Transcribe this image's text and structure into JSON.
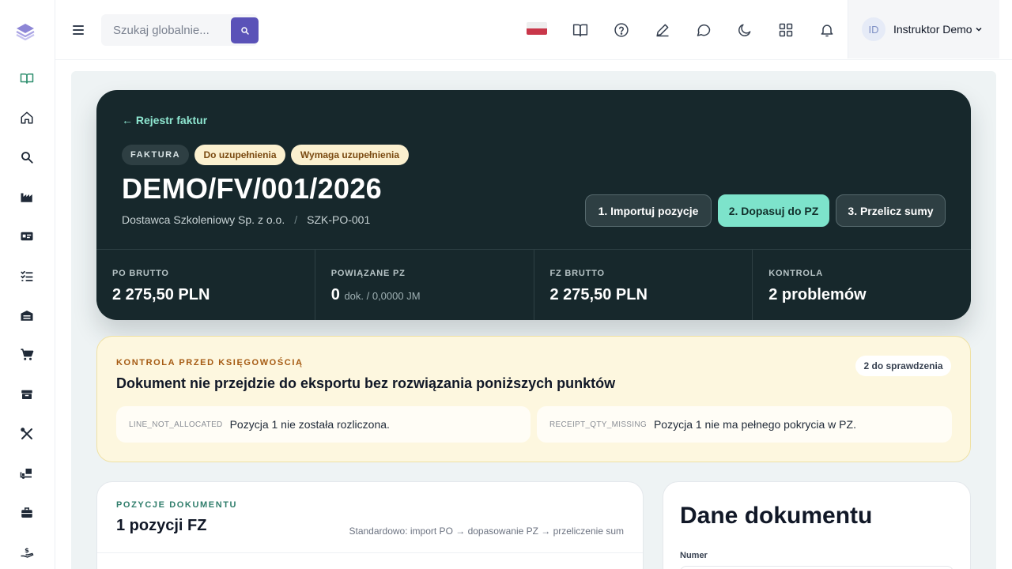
{
  "sidebar": {
    "logo": "layers-logo-icon",
    "items": [
      {
        "icon": "book-open-icon",
        "active": true
      },
      {
        "icon": "home-icon"
      },
      {
        "icon": "search-zoom-icon"
      },
      {
        "icon": "factory-icon"
      },
      {
        "icon": "id-card-icon"
      },
      {
        "icon": "list-check-icon"
      },
      {
        "icon": "warehouse-icon"
      },
      {
        "icon": "cart-icon"
      },
      {
        "icon": "box-icon"
      },
      {
        "icon": "tools-icon"
      },
      {
        "icon": "truck-loading-icon"
      },
      {
        "icon": "briefcase-icon"
      },
      {
        "icon": "hand-dollar-icon"
      }
    ]
  },
  "topbar": {
    "search_placeholder": "Szukaj globalnie...",
    "icons": [
      "book-icon",
      "help-circle-icon",
      "pen-icon",
      "chat-icon",
      "moon-icon",
      "grid-icon",
      "bell-icon"
    ],
    "user": {
      "initials": "ID",
      "name": "Instruktor Demo"
    }
  },
  "hero": {
    "back_link": "← Rejestr faktur",
    "chips": [
      "FAKTURA",
      "Do uzupełnienia",
      "Wymaga uzupełnienia"
    ],
    "title": "DEMO/FV/001/2026",
    "supplier": "Dostawca Szkoleniowy Sp. z o.o.",
    "separator": "/",
    "po_ref": "SZK-PO-001",
    "steps": [
      "1. Importuj pozycje",
      "2. Dopasuj do PZ",
      "3. Przelicz sumy"
    ],
    "stats": [
      {
        "label": "PO BRUTTO",
        "value": "2 275,50 PLN",
        "extra": ""
      },
      {
        "label": "POWIĄZANE PZ",
        "value": "0",
        "extra": "dok. / 0,0000 JM"
      },
      {
        "label": "FZ BRUTTO",
        "value": "2 275,50 PLN",
        "extra": ""
      },
      {
        "label": "KONTROLA",
        "value": "2 problemów",
        "extra": ""
      }
    ]
  },
  "control": {
    "eyebrow": "KONTROLA PRZED KSIĘGOWOŚCIĄ",
    "title": "Dokument nie przejdzie do eksportu bez rozwiązania poniższych punktów",
    "badge": "2 do sprawdzenia",
    "issues": [
      {
        "code": "LINE_NOT_ALLOCATED",
        "text": "Pozycja 1 nie została rozliczona."
      },
      {
        "code": "RECEIPT_QTY_MISSING",
        "text": "Pozycja 1 nie ma pełnego pokrycia w PZ."
      }
    ]
  },
  "lines": {
    "eyebrow": "POZYCJE DOKUMENTU",
    "title": "1 pozycji FZ",
    "hint": "Standardowo: import PO → dopasowanie PZ → przeliczenie sum"
  },
  "data_card": {
    "title": "Dane dokumentu",
    "field_label": "Numer"
  },
  "colors": {
    "hero_bg": "#17282c",
    "accent_teal": "#7de3cb",
    "search_button": "#5a52b8",
    "warning_bg": "#fdf7df",
    "warning_text": "#a55a12"
  }
}
